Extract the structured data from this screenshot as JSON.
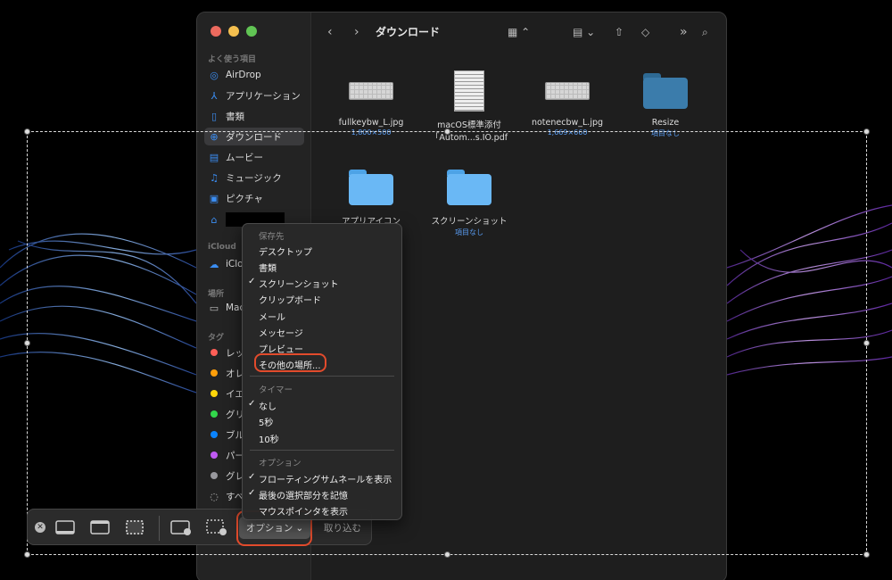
{
  "colors": {
    "accent": "#3b8ef3",
    "highlight_ring": "#e24b2c",
    "folder": "#6ab8f5"
  },
  "finder": {
    "title": "ダウンロード",
    "sidebar": {
      "favorites_label": "よく使う項目",
      "favorites": [
        {
          "label": "AirDrop",
          "icon": "airdrop-icon"
        },
        {
          "label": "アプリケーション",
          "icon": "applications-icon"
        },
        {
          "label": "書類",
          "icon": "document-icon"
        },
        {
          "label": "ダウンロード",
          "icon": "download-icon",
          "active": true
        },
        {
          "label": "ムービー",
          "icon": "film-icon"
        },
        {
          "label": "ミュージック",
          "icon": "music-icon"
        },
        {
          "label": "ピクチャ",
          "icon": "picture-icon"
        }
      ],
      "icloud_label": "iCloud",
      "icloud_item": "iClo",
      "locations_label": "場所",
      "locations_item": "Mac",
      "tags_label": "タグ",
      "tags": [
        {
          "label": "レッ",
          "color": "#ff5f57"
        },
        {
          "label": "オレ",
          "color": "#ff9f0a"
        },
        {
          "label": "イエ",
          "color": "#ffd60a"
        },
        {
          "label": "グリ",
          "color": "#32d74b"
        },
        {
          "label": "ブル",
          "color": "#0a84ff"
        },
        {
          "label": "パー",
          "color": "#bf5af2"
        },
        {
          "label": "グレ",
          "color": "#98989d"
        }
      ],
      "all_tags": "すべ"
    },
    "files": [
      {
        "name": "fullkeybw_L.jpg",
        "meta": "1,800×500"
      },
      {
        "name": "macOS標準添付",
        "name2": "「Autom...s.IO.pdf"
      },
      {
        "name": "notenecbw_L.jpg",
        "meta": "1,669×660"
      },
      {
        "name": "Resize",
        "meta": "項目なし"
      },
      {
        "name": "アプリアイコン"
      },
      {
        "name": "スクリーンショット",
        "meta": "項目なし"
      }
    ]
  },
  "menu": {
    "save_to_label": "保存先",
    "save_to": [
      "デスクトップ",
      "書類",
      "スクリーンショット",
      "クリップボード",
      "メール",
      "メッセージ",
      "プレビュー",
      "その他の場所..."
    ],
    "timer_label": "タイマー",
    "timer": [
      "なし",
      "5秒",
      "10秒"
    ],
    "options_label": "オプション",
    "options": [
      "フローティングサムネールを表示",
      "最後の選択部分を記憶",
      "マウスポインタを表示"
    ]
  },
  "shotbar": {
    "options_label": "オプション",
    "capture_label": "取り込む"
  }
}
